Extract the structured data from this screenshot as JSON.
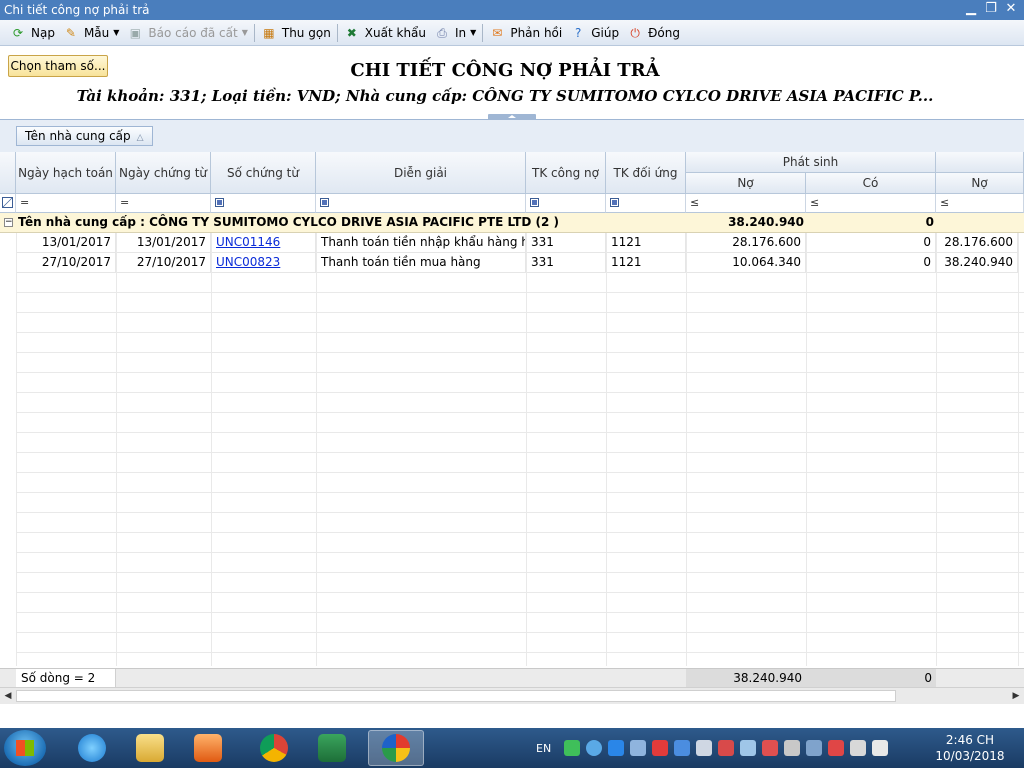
{
  "window": {
    "title": "Chi tiết công nợ phải trả"
  },
  "toolbar": {
    "nap": "Nạp",
    "mau": "Mẫu",
    "bao_cao_da_cat": "Báo cáo đã cất",
    "thu_gon": "Thu gọn",
    "xuat_khau": "Xuất khẩu",
    "in": "In",
    "phan_hoi": "Phản hồi",
    "giup": "Giúp",
    "dong": "Đóng"
  },
  "choose_params_label": "Chọn tham số...",
  "report": {
    "title": "CHI TIẾT CÔNG NỢ PHẢI TRẢ",
    "subtitle": "Tài khoản: 331; Loại tiền: VND; Nhà cung cấp: CÔNG TY SUMITOMO CYLCO DRIVE ASIA PACIFIC P..."
  },
  "group_panel": {
    "chip": "Tên nhà cung cấp"
  },
  "columns": {
    "ngay_hach_toan": "Ngày hạch toán",
    "ngay_chung_tu": "Ngày chứng từ",
    "so_chung_tu": "Số chứng từ",
    "dien_giai": "Diễn giải",
    "tk_cong_no": "TK công nợ",
    "tk_doi_ung": "TK đối ứng",
    "phat_sinh": "Phát sinh",
    "no": "Nợ",
    "co": "Có",
    "no2": "Nợ"
  },
  "filter_ops": {
    "eq": "=",
    "le": "≤"
  },
  "group": {
    "label": "Tên nhà cung cấp : CÔNG TY SUMITOMO CYLCO DRIVE ASIA PACIFIC PTE LTD (2 )",
    "no_total": "38.240.940",
    "co_total": "0"
  },
  "rows": [
    {
      "ngay_hach_toan": "13/01/2017",
      "ngay_chung_tu": "13/01/2017",
      "so_chung_tu": "UNC01146",
      "dien_giai": "Thanh toán tiền nhập khẩu hàng hóa",
      "tk_cong_no": "331",
      "tk_doi_ung": "1121",
      "no": "28.176.600",
      "co": "0",
      "no2": "28.176.600"
    },
    {
      "ngay_hach_toan": "27/10/2017",
      "ngay_chung_tu": "27/10/2017",
      "so_chung_tu": "UNC00823",
      "dien_giai": "Thanh toán tiền mua hàng",
      "tk_cong_no": "331",
      "tk_doi_ung": "1121",
      "no": "10.064.340",
      "co": "0",
      "no2": "38.240.940"
    }
  ],
  "footer": {
    "row_count": "Số dòng = 2",
    "no_total": "38.240.940",
    "co_total": "0"
  },
  "taskbar": {
    "lang": "EN",
    "time": "2:46 CH",
    "date": "10/03/2018"
  }
}
